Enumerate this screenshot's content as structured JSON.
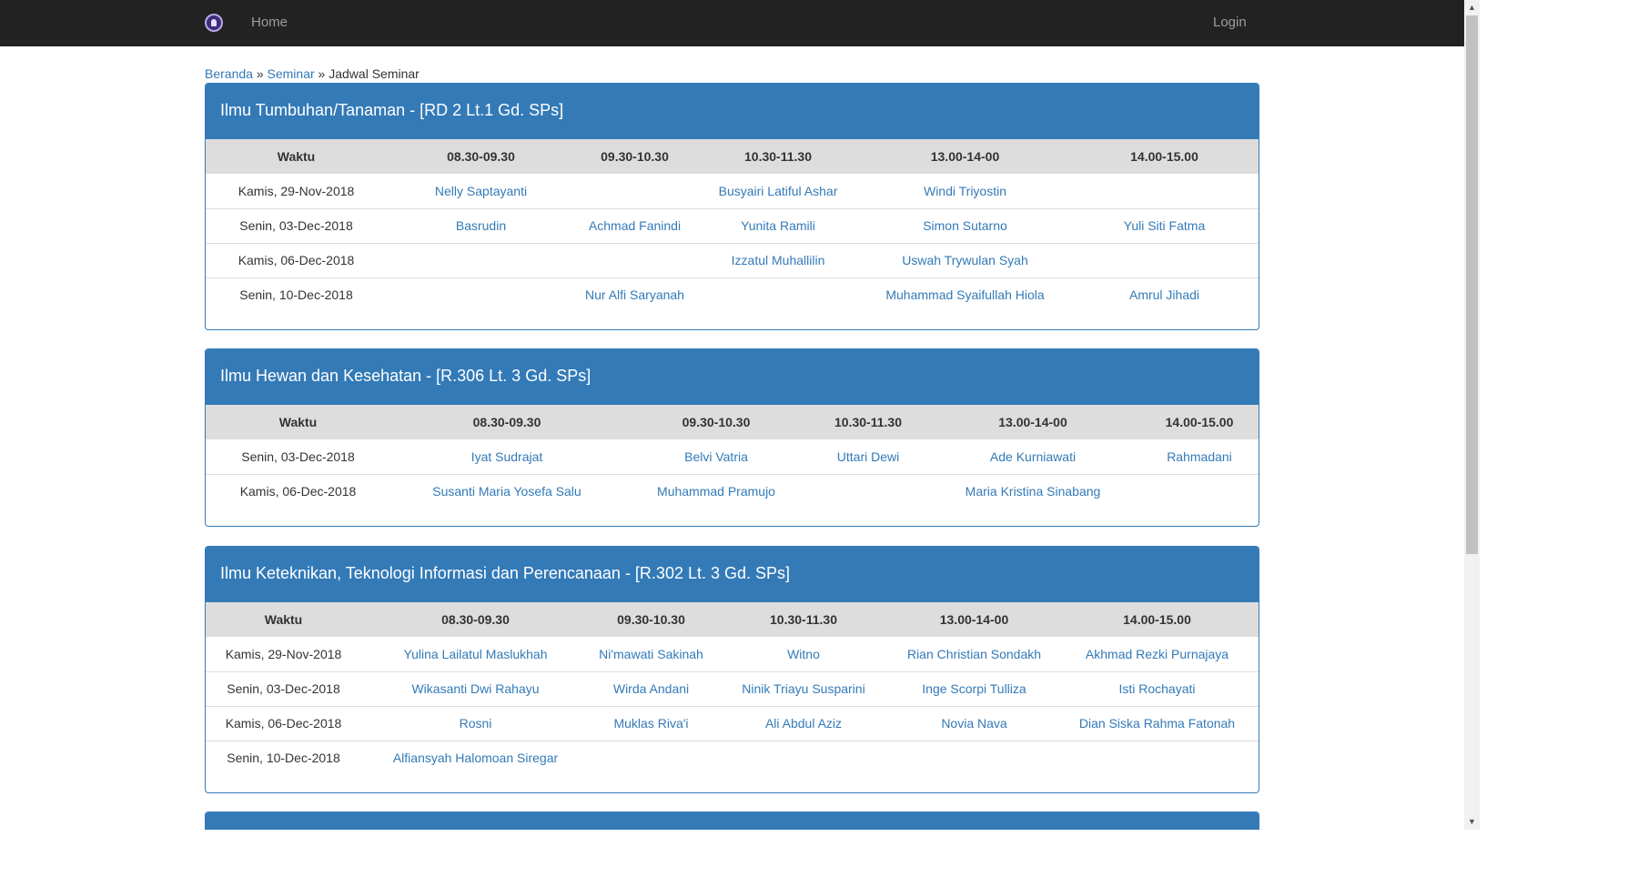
{
  "navbar": {
    "home_label": "Home",
    "login_label": "Login",
    "logo_icon": "university-logo-icon"
  },
  "breadcrumb": {
    "home": "Beranda",
    "sep1": "»",
    "seminar": "Seminar",
    "sep2": "»",
    "current": "Jadwal Seminar"
  },
  "colors": {
    "primary": "#337ab7",
    "navbar": "#222222",
    "header_row": "#dddddd"
  },
  "panels": [
    {
      "title": "Ilmu Tumbuhan/Tanaman - [RD 2 Lt.1 Gd. SPs]",
      "columns": [
        "Waktu",
        "08.30-09.30",
        "09.30-10.30",
        "10.30-11.30",
        "13.00-14-00",
        "14.00-15.00"
      ],
      "rows": [
        [
          "Kamis, 29-Nov-2018",
          "Nelly Saptayanti",
          "",
          "Busyairi Latiful Ashar",
          "Windi Triyostin",
          ""
        ],
        [
          "Senin, 03-Dec-2018",
          "Basrudin",
          "Achmad Fanindi",
          "Yunita Ramili",
          "Simon Sutarno",
          "Yuli Siti Fatma"
        ],
        [
          "Kamis, 06-Dec-2018",
          "",
          "",
          "Izzatul Muhallilin",
          "Uswah Trywulan Syah",
          ""
        ],
        [
          "Senin, 10-Dec-2018",
          "",
          "Nur Alfi Saryanah",
          "",
          "Muhammad Syaifullah Hiola",
          "Amrul Jihadi"
        ]
      ]
    },
    {
      "title": "Ilmu Hewan dan Kesehatan - [R.306 Lt. 3 Gd. SPs]",
      "columns": [
        "Waktu",
        "08.30-09.30",
        "09.30-10.30",
        "10.30-11.30",
        "13.00-14-00",
        "14.00-15.00"
      ],
      "rows": [
        [
          "Senin, 03-Dec-2018",
          "Iyat Sudrajat",
          "Belvi Vatria",
          "Uttari Dewi",
          "Ade Kurniawati",
          "Rahmadani"
        ],
        [
          "Kamis, 06-Dec-2018",
          "Susanti Maria Yosefa Salu",
          "Muhammad Pramujo",
          "",
          "Maria Kristina Sinabang",
          ""
        ]
      ]
    },
    {
      "title": "Ilmu Keteknikan, Teknologi Informasi dan Perencanaan - [R.302 Lt. 3 Gd. SPs]",
      "columns": [
        "Waktu",
        "08.30-09.30",
        "09.30-10.30",
        "10.30-11.30",
        "13.00-14-00",
        "14.00-15.00"
      ],
      "rows": [
        [
          "Kamis, 29-Nov-2018",
          "Yulina Lailatul Maslukhah",
          "Ni'mawati Sakinah",
          "Witno",
          "Rian Christian Sondakh",
          "Akhmad Rezki Purnajaya"
        ],
        [
          "Senin, 03-Dec-2018",
          "Wikasanti Dwi Rahayu",
          "Wirda Andani",
          "Ninik Triayu Susparini",
          "Inge Scorpi Tulliza",
          "Isti Rochayati"
        ],
        [
          "Kamis, 06-Dec-2018",
          "Rosni",
          "Muklas Riva'i",
          "Ali Abdul Aziz",
          "Novia Nava",
          "Dian Siska Rahma Fatonah"
        ],
        [
          "Senin, 10-Dec-2018",
          "Alfiansyah Halomoan Siregar",
          "",
          "",
          "",
          ""
        ]
      ]
    }
  ]
}
